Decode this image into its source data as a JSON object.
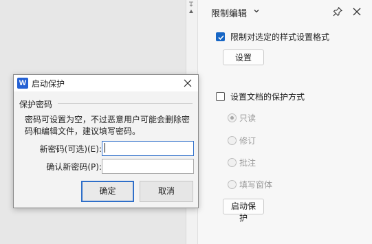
{
  "panel": {
    "title": "限制编辑",
    "restrict_format": {
      "label": "限制对选定的样式设置格式",
      "checked": true,
      "settings_button": "设置"
    },
    "protection": {
      "label": "设置文档的保护方式",
      "checked": false,
      "options": [
        {
          "label": "只读",
          "selected": true
        },
        {
          "label": "修订",
          "selected": false
        },
        {
          "label": "批注",
          "selected": false
        },
        {
          "label": "填写窗体",
          "selected": false
        }
      ],
      "start_button": "启动保护"
    }
  },
  "dialog": {
    "title": "启动保护",
    "app_icon_letter": "W",
    "group_caption": "保护密码",
    "description": "密码可设置为空，不过恶意用户可能会删除密码和编辑文件，建议填写密码。",
    "new_password_label": "新密码(可选)(E):",
    "new_password_value": "",
    "confirm_password_label": "确认新密码(P):",
    "confirm_password_value": "",
    "ok_button": "确定",
    "cancel_button": "取消"
  },
  "colors": {
    "accent": "#1766c5",
    "focus_border": "#2f6fc9",
    "app_icon": "#2561d4"
  }
}
